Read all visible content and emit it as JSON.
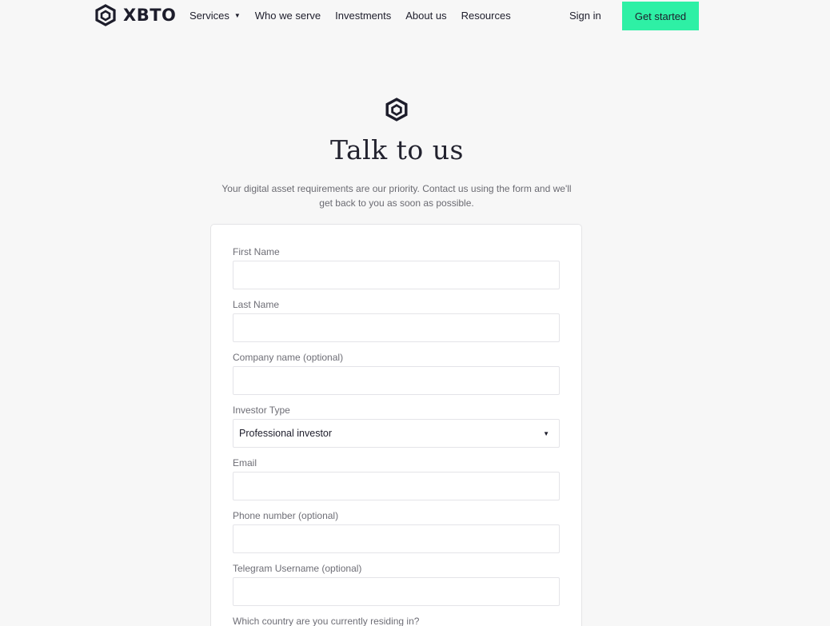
{
  "header": {
    "brand": "XBTO",
    "nav": [
      {
        "label": "Services",
        "has_dropdown": true
      },
      {
        "label": "Who we serve"
      },
      {
        "label": "Investments"
      },
      {
        "label": "About us"
      },
      {
        "label": "Resources"
      }
    ],
    "sign_in": "Sign in",
    "get_started": "Get started",
    "cta_color": "#2ef0a5"
  },
  "hero": {
    "icon": "xbto-logo-icon",
    "title": "Talk to us",
    "subtitle": "Your digital asset requirements are our priority. Contact us using the form and we'll get back to you as soon as possible."
  },
  "form": {
    "first_name": {
      "label": "First Name",
      "value": ""
    },
    "last_name": {
      "label": "Last Name",
      "value": ""
    },
    "company": {
      "label": "Company name (optional)",
      "value": ""
    },
    "investor_type": {
      "label": "Investor Type",
      "selected": "Professional investor"
    },
    "email": {
      "label": "Email",
      "value": ""
    },
    "phone": {
      "label": "Phone number (optional)",
      "value": ""
    },
    "telegram": {
      "label": "Telegram Username (optional)",
      "value": ""
    },
    "country": {
      "label": "Which country are you currently residing in?"
    }
  }
}
